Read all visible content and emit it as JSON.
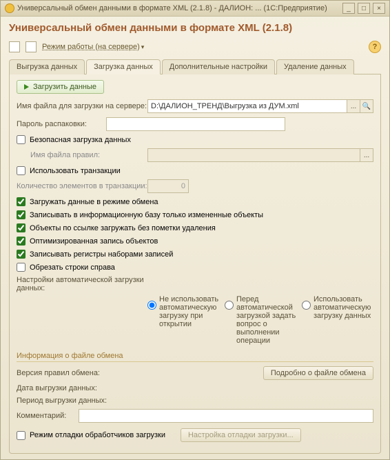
{
  "window": {
    "title": "Универсальный обмен данными в формате XML (2.1.8) - ДАЛИОН: ...   (1С:Предприятие)",
    "min": "_",
    "max": "□",
    "close": "×"
  },
  "heading": "Универсальный обмен данными в формате XML (2.1.8)",
  "toolbar": {
    "mode_label": "Режим работы (на сервере)",
    "help": "?"
  },
  "tabs": {
    "export": "Выгрузка данных",
    "import": "Загрузка данных",
    "extra": "Дополнительные настройки",
    "delete": "Удаление данных"
  },
  "import": {
    "load_btn": "Загрузить данные",
    "filename_label": "Имя файла для загрузки на сервере:",
    "filename_value": "D:\\ДАЛИОН_ТРЕНД\\Выгрузка из ДУМ.xml",
    "ellipsis": "...",
    "magnifier": "🔍",
    "password_label": "Пароль распаковки:",
    "password_value": "",
    "safe_label": "Безопасная загрузка данных",
    "safe_checked": false,
    "rules_label": "Имя файла правил:",
    "rules_value": "",
    "tx_label": "Использовать транзакции",
    "tx_checked": false,
    "tx_count_label": "Количество элементов в транзакции:",
    "tx_count_value": "0",
    "cb1": "Загружать данные в режиме обмена",
    "cb2": "Записывать в информационную базу только измененные объекты",
    "cb3": "Объекты по ссылке загружать без пометки удаления",
    "cb4": "Оптимизированная запись объектов",
    "cb5": "Записывать регистры наборами записей",
    "cb6": "Обрезать строки справа",
    "cb1v": true,
    "cb2v": true,
    "cb3v": true,
    "cb4v": true,
    "cb5v": true,
    "cb6v": false,
    "autoload_label": "Настройки автоматической загрузки данных:",
    "r1": "Не использовать автоматическую загрузку при открытии",
    "r2": "Перед автоматической загрузкой задать вопрос о выполнении операции",
    "r3": "Использовать автоматическую загрузку данных",
    "file_info_legend": "Информация о файле обмена",
    "rules_version_label": "Версия правил обмена:",
    "file_details_btn": "Подробно о файле обмена",
    "export_date_label": "Дата выгрузки данных:",
    "export_period_label": "Период выгрузки данных:",
    "comment_label": "Комментарий:",
    "comment_value": "",
    "debug_label": "Режим отладки обработчиков загрузки",
    "debug_checked": false,
    "debug_btn": "Настройка отладки загрузки..."
  }
}
